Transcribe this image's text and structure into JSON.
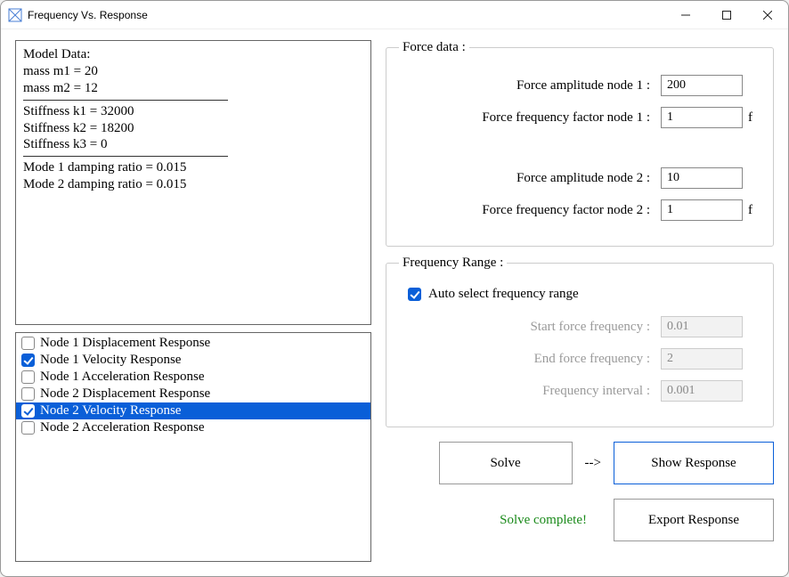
{
  "window": {
    "title": "Frequency Vs. Response"
  },
  "modelData": {
    "heading": "Model Data:",
    "lines1": [
      "mass m1 = 20",
      "mass m2 = 12"
    ],
    "lines2": [
      "Stiffness k1 = 32000",
      "Stiffness k2 = 18200",
      "Stiffness k3 = 0"
    ],
    "lines3": [
      "Mode 1 damping ratio = 0.015",
      "Mode 2 damping ratio = 0.015"
    ]
  },
  "responseOptions": [
    {
      "label": "Node 1 Displacement Response",
      "checked": false,
      "selected": false
    },
    {
      "label": "Node 1 Velocity Response",
      "checked": true,
      "selected": false
    },
    {
      "label": "Node 1 Acceleration Response",
      "checked": false,
      "selected": false
    },
    {
      "label": "Node 2 Displacement Response",
      "checked": false,
      "selected": false
    },
    {
      "label": "Node 2 Velocity Response",
      "checked": true,
      "selected": true
    },
    {
      "label": "Node 2 Acceleration Response",
      "checked": false,
      "selected": false
    }
  ],
  "forceData": {
    "legend": "Force data :",
    "amp1_label": "Force amplitude node 1 :",
    "amp1_value": "200",
    "freq1_label": "Force frequency factor node 1 :",
    "freq1_value": "1",
    "freq1_suffix": "f",
    "amp2_label": "Force amplitude node 2 :",
    "amp2_value": "10",
    "freq2_label": "Force frequency factor node 2 :",
    "freq2_value": "1",
    "freq2_suffix": "f"
  },
  "freqRange": {
    "legend": "Frequency Range :",
    "auto_label": "Auto select frequency range",
    "auto_checked": true,
    "start_label": "Start force frequency :",
    "start_value": "0.01",
    "end_label": "End force frequency :",
    "end_value": "2",
    "interval_label": "Frequency interval :",
    "interval_value": "0.001"
  },
  "buttons": {
    "solve": "Solve",
    "arrow": "-->",
    "show": "Show Response",
    "export": "Export Response"
  },
  "status": "Solve complete!"
}
